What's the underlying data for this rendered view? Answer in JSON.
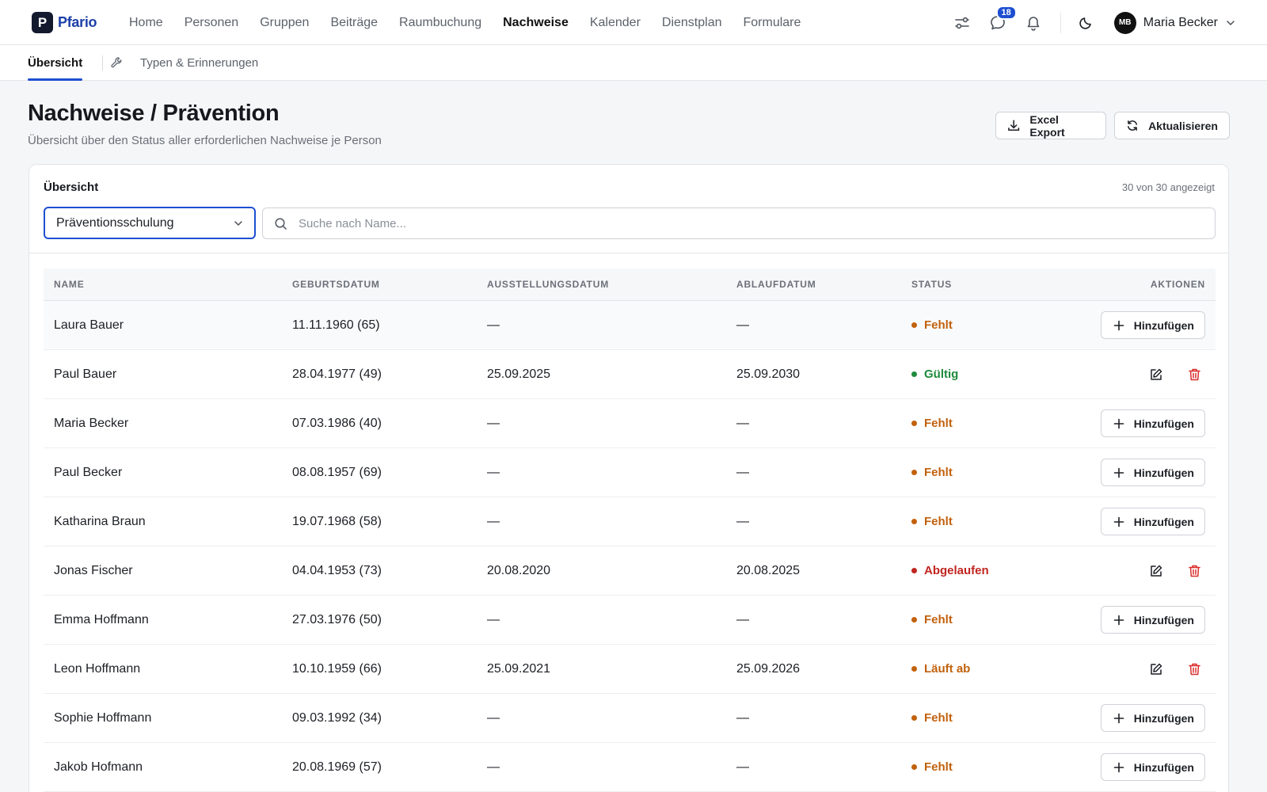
{
  "app": {
    "logo_letter": "P",
    "logo_text": "Pfario"
  },
  "nav": {
    "items": [
      "Home",
      "Personen",
      "Gruppen",
      "Beiträge",
      "Raumbuchung",
      "Nachweise",
      "Kalender",
      "Dienstplan",
      "Formulare"
    ],
    "active": "Nachweise"
  },
  "user": {
    "initials": "MB",
    "name": "Maria Becker",
    "messages_badge": "18"
  },
  "subnav": {
    "tab_overview": "Übersicht",
    "tab_types": "Typen & Erinnerungen"
  },
  "header": {
    "title": "Nachweise / Prävention",
    "subtitle": "Übersicht über den Status aller erforderlichen Nachweise je Person",
    "export_label": "Excel Export",
    "refresh_label": "Aktualisieren"
  },
  "card": {
    "title": "Übersicht",
    "count": "30 von 30 angezeigt",
    "select_value": "Präventionsschulung",
    "search_placeholder": "Suche nach Name..."
  },
  "table": {
    "columns": {
      "name": "NAME",
      "birth": "GEBURTSDATUM",
      "issue": "AUSSTELLUNGSDATUM",
      "expiry": "ABLAUFDATUM",
      "status": "STATUS",
      "actions": "AKTIONEN"
    },
    "add_label": "Hinzufügen",
    "rows": [
      {
        "name": "Laura Bauer",
        "birth": "11.11.1960 (65)",
        "issue": "—",
        "expiry": "—",
        "status": "Fehlt",
        "has_record": false
      },
      {
        "name": "Paul Bauer",
        "birth": "28.04.1977 (49)",
        "issue": "25.09.2025",
        "expiry": "25.09.2030",
        "status": "Gültig",
        "has_record": true
      },
      {
        "name": "Maria Becker",
        "birth": "07.03.1986 (40)",
        "issue": "—",
        "expiry": "—",
        "status": "Fehlt",
        "has_record": false
      },
      {
        "name": "Paul Becker",
        "birth": "08.08.1957 (69)",
        "issue": "—",
        "expiry": "—",
        "status": "Fehlt",
        "has_record": false
      },
      {
        "name": "Katharina Braun",
        "birth": "19.07.1968 (58)",
        "issue": "—",
        "expiry": "—",
        "status": "Fehlt",
        "has_record": false
      },
      {
        "name": "Jonas Fischer",
        "birth": "04.04.1953 (73)",
        "issue": "20.08.2020",
        "expiry": "20.08.2025",
        "status": "Abgelaufen",
        "has_record": true
      },
      {
        "name": "Emma Hoffmann",
        "birth": "27.03.1976 (50)",
        "issue": "—",
        "expiry": "—",
        "status": "Fehlt",
        "has_record": false
      },
      {
        "name": "Leon Hoffmann",
        "birth": "10.10.1959 (66)",
        "issue": "25.09.2021",
        "expiry": "25.09.2026",
        "status": "Läuft ab",
        "has_record": true
      },
      {
        "name": "Sophie Hoffmann",
        "birth": "09.03.1992 (34)",
        "issue": "—",
        "expiry": "—",
        "status": "Fehlt",
        "has_record": false
      },
      {
        "name": "Jakob Hofmann",
        "birth": "20.08.1969 (57)",
        "issue": "—",
        "expiry": "—",
        "status": "Fehlt",
        "has_record": false
      }
    ]
  },
  "status_colors": {
    "Fehlt": "#c2610c",
    "Gültig": "#1e8a3c",
    "Abgelaufen": "#c0251f",
    "Läuft ab": "#c2610c"
  },
  "colors": {
    "accent": "#1e4fd1",
    "delete": "#d92d2a"
  }
}
